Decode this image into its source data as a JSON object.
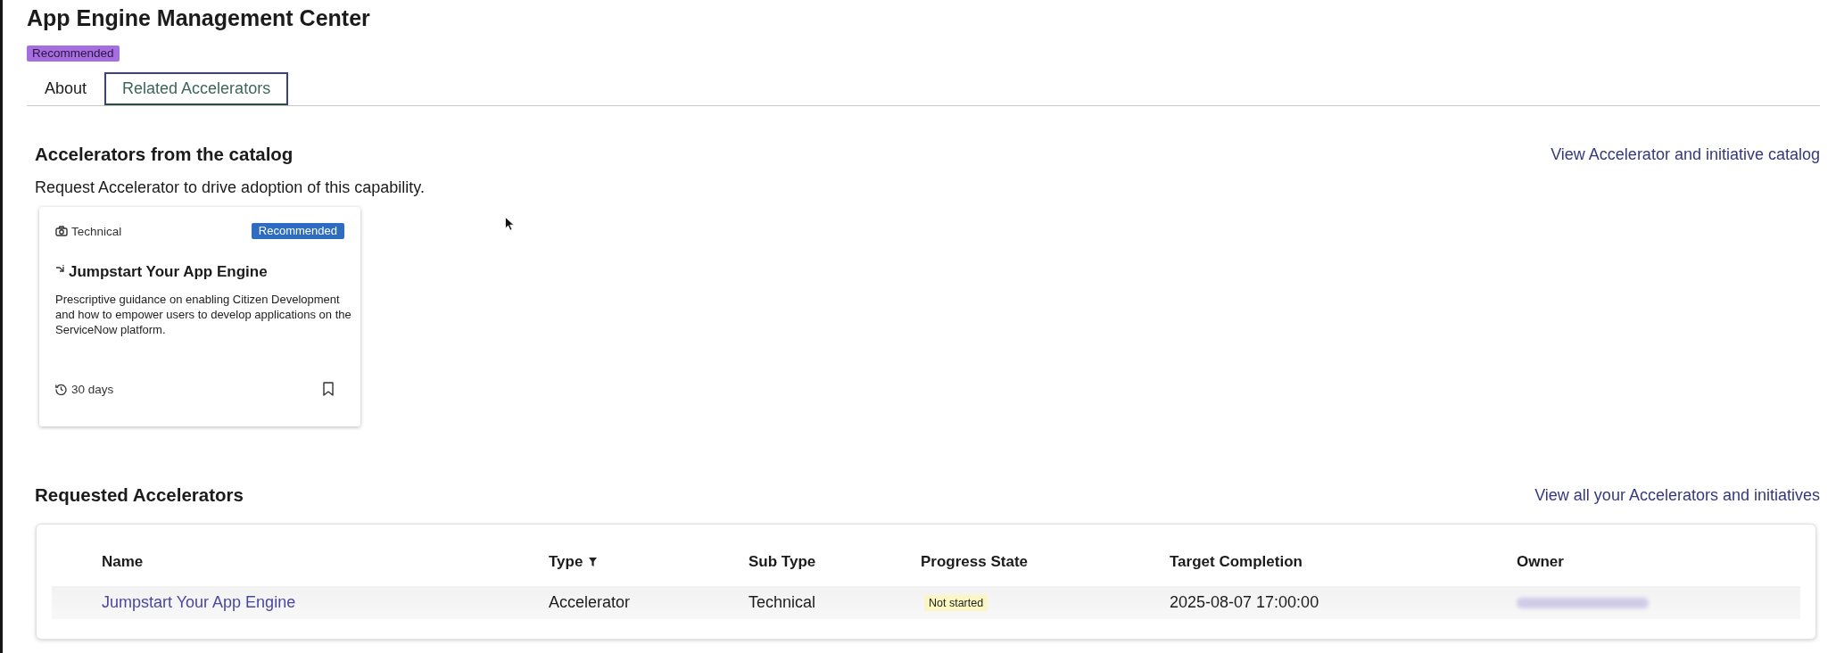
{
  "page": {
    "title": "App Engine Management Center",
    "badge": "Recommended"
  },
  "tabs": [
    {
      "label": "About",
      "selected": false
    },
    {
      "label": "Related Accelerators",
      "selected": true
    }
  ],
  "catalog": {
    "heading": "Accelerators from the catalog",
    "link": "View Accelerator and initiative catalog",
    "description": "Request Accelerator to drive adoption of this capability.",
    "cards": [
      {
        "category": "Technical",
        "badge": "Recommended",
        "title": "Jumpstart Your App Engine",
        "description": "Prescriptive guidance on enabling Citizen Development and how to empower users to develop applications on the ServiceNow platform.",
        "duration": "30 days",
        "bookmarked": false
      }
    ]
  },
  "requested": {
    "heading": "Requested Accelerators",
    "link": "View all your Accelerators and initiatives",
    "table": {
      "columns": [
        {
          "label": "Name",
          "filter": false
        },
        {
          "label": "Type",
          "filter": true
        },
        {
          "label": "Sub Type",
          "filter": false
        },
        {
          "label": "Progress State",
          "filter": false
        },
        {
          "label": "Target Completion",
          "filter": false
        },
        {
          "label": "Owner",
          "filter": false
        }
      ],
      "rows": [
        {
          "cells": [
            {
              "kind": "link",
              "text": "Jumpstart Your App Engine"
            },
            {
              "kind": "text",
              "text": "Accelerator"
            },
            {
              "kind": "text",
              "text": "Technical"
            },
            {
              "kind": "status",
              "text": "Not started"
            },
            {
              "kind": "text",
              "text": "2025-08-07 17:00:00"
            },
            {
              "kind": "blurred"
            }
          ]
        }
      ]
    }
  }
}
